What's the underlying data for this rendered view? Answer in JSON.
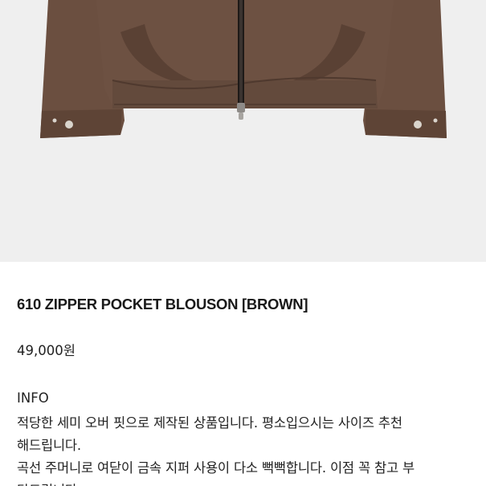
{
  "product": {
    "image_alt": "brown zipper pocket blouson jacket photo",
    "title": "610 ZIPPER POCKET BLOUSON [BROWN]",
    "price": "49,000원",
    "description": {
      "heading": "INFO",
      "lines": [
        "적당한 세미 오버 핏으로 제작된 상품입니다. 평소입으시는 사이즈 추천",
        "해드립니다.",
        "곡선 주머니로 여닫이 금속 지퍼 사용이 다소 뻑뻑합니다. 이점 꼭 참고 부",
        "탁드립니다."
      ]
    }
  },
  "colors": {
    "background": "#efefef",
    "jacket": "#6b4f40",
    "jacket_shadow": "#533c30",
    "zipper": "#1e1a18",
    "snap": "#d9d4cc"
  }
}
